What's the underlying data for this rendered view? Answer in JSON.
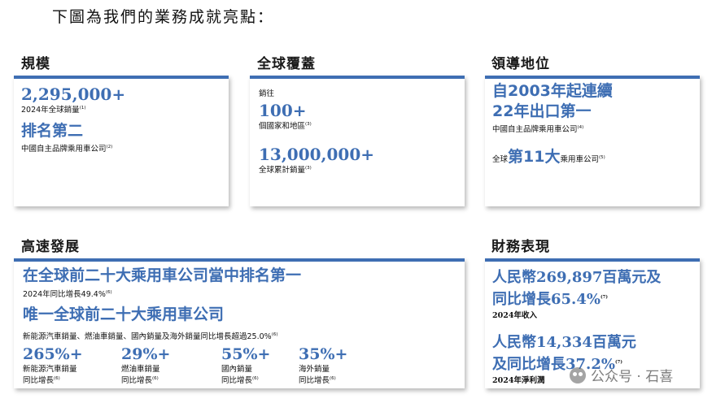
{
  "intro": "下圖為我們的業務成就亮點：",
  "scale": {
    "title": "規模",
    "value": "2,295,000+",
    "value_caption": "2024年全球銷量",
    "value_fn": "(1)",
    "rank": "排名第二",
    "rank_caption": "中國自主品牌乘用車公司",
    "rank_fn": "(2)"
  },
  "global": {
    "title": "全球覆蓋",
    "prefix": "銷往",
    "countries": "100+",
    "countries_caption": "個國家和地區",
    "countries_fn": "(3)",
    "cumulative": "13,000,000+",
    "cumulative_caption": "全球累計銷量",
    "cumulative_fn": "(3)"
  },
  "leadership": {
    "title": "領導地位",
    "line1": "自2003年起連續",
    "line2": "22年出口第一",
    "caption": "中國自主品牌乘用車公司",
    "caption_fn": "(4)",
    "rank_prefix": "全球",
    "rank_highlight": "第11大",
    "rank_suffix": "乘用車公司",
    "rank_fn": "(5)"
  },
  "growth": {
    "title": "高速發展",
    "headline1": "在全球前二十大乘用車公司當中排名第一",
    "caption1": "2024年同比增長49.4%",
    "caption1_fn": "(6)",
    "headline2": "唯一全球前二十大乘用車公司",
    "caption2": "新能源汽車銷量、燃油車銷量、國內銷量及海外銷量同比增長超過25.0%",
    "caption2_fn": "(6)",
    "stats": [
      {
        "value": "265%+",
        "line1": "新能源汽車銷量",
        "line2": "同比增長",
        "fn": "(6)"
      },
      {
        "value": "29%+",
        "line1": "燃油車銷量",
        "line2": "同比增長",
        "fn": "(6)"
      },
      {
        "value": "55%+",
        "line1": "國內銷量",
        "line2": "同比增長",
        "fn": "(6)"
      },
      {
        "value": "35%+",
        "line1": "海外銷量",
        "line2": "同比增長",
        "fn": "(6)"
      }
    ]
  },
  "finance": {
    "title": "財務表現",
    "revenue_line1": "人民幣269,897百萬元及",
    "revenue_line2": "同比增長65.4%",
    "revenue_fn": "(7)",
    "revenue_caption": "2024年收入",
    "profit_line1": "人民幣14,334百萬元",
    "profit_line2": "及同比增長37.2%",
    "profit_fn": "(7)",
    "profit_caption": "2024年淨利潤"
  },
  "watermark": "公众号 · 石喜"
}
